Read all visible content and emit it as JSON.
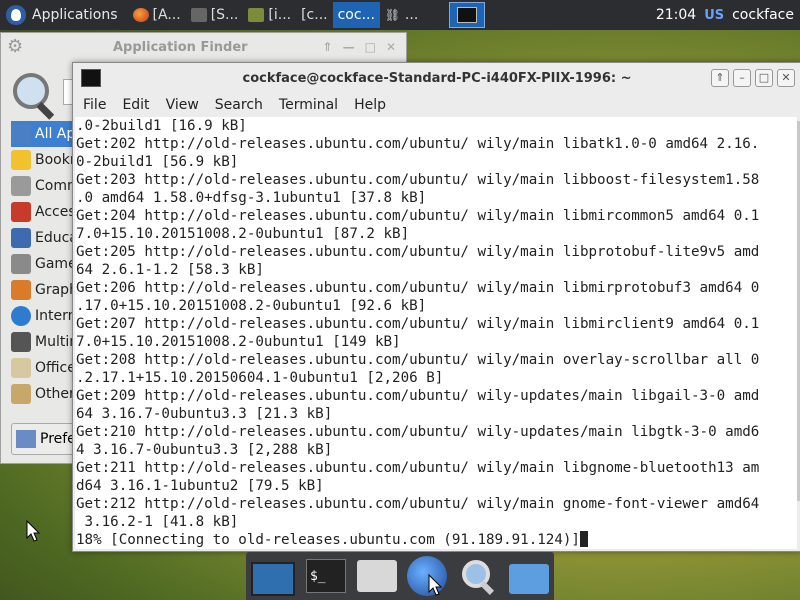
{
  "top_panel": {
    "applications_label": "Applications",
    "tasks": [
      {
        "label": "[A...",
        "icon": "firefox-icon"
      },
      {
        "label": "[S...",
        "icon": "window-icon"
      },
      {
        "label": "[i...",
        "icon": "image-icon"
      },
      {
        "label": "[c...",
        "icon": "terminal-icon"
      },
      {
        "label": "coc...",
        "icon": "terminal-icon"
      },
      {
        "label": "...",
        "icon": "chain-icon"
      }
    ],
    "clock": "21:04",
    "keyboard_layout": "US",
    "user": "cockface"
  },
  "app_finder": {
    "title": "Application Finder",
    "categories": [
      "All Applications",
      "Bookmarks",
      "Common",
      "Accessories",
      "Education",
      "Games",
      "Graphics",
      "Internet",
      "Multimedia",
      "Office",
      "Other"
    ],
    "preferences_label": "Preferences"
  },
  "terminal": {
    "title": "cockface@cockface-Standard-PC-i440FX-PIIX-1996: ~",
    "menu": [
      "File",
      "Edit",
      "View",
      "Search",
      "Terminal",
      "Help"
    ],
    "lines": [
      ".0-2build1 [16.9 kB]",
      "Get:202 http://old-releases.ubuntu.com/ubuntu/ wily/main libatk1.0-0 amd64 2.16.",
      "0-2build1 [56.9 kB]",
      "Get:203 http://old-releases.ubuntu.com/ubuntu/ wily/main libboost-filesystem1.58",
      ".0 amd64 1.58.0+dfsg-3.1ubuntu1 [37.8 kB]",
      "Get:204 http://old-releases.ubuntu.com/ubuntu/ wily/main libmircommon5 amd64 0.1",
      "7.0+15.10.20151008.2-0ubuntu1 [87.2 kB]",
      "Get:205 http://old-releases.ubuntu.com/ubuntu/ wily/main libprotobuf-lite9v5 amd",
      "64 2.6.1-1.2 [58.3 kB]",
      "Get:206 http://old-releases.ubuntu.com/ubuntu/ wily/main libmirprotobuf3 amd64 0",
      ".17.0+15.10.20151008.2-0ubuntu1 [92.6 kB]",
      "Get:207 http://old-releases.ubuntu.com/ubuntu/ wily/main libmirclient9 amd64 0.1",
      "7.0+15.10.20151008.2-0ubuntu1 [149 kB]",
      "Get:208 http://old-releases.ubuntu.com/ubuntu/ wily/main overlay-scrollbar all 0",
      ".2.17.1+15.10.20150604.1-0ubuntu1 [2,206 B]",
      "Get:209 http://old-releases.ubuntu.com/ubuntu/ wily-updates/main libgail-3-0 amd",
      "64 3.16.7-0ubuntu3.3 [21.3 kB]",
      "Get:210 http://old-releases.ubuntu.com/ubuntu/ wily-updates/main libgtk-3-0 amd6",
      "4 3.16.7-0ubuntu3.3 [2,288 kB]",
      "Get:211 http://old-releases.ubuntu.com/ubuntu/ wily/main libgnome-bluetooth13 am",
      "d64 3.16.1-1ubuntu2 [79.5 kB]",
      "Get:212 http://old-releases.ubuntu.com/ubuntu/ wily/main gnome-font-viewer amd64",
      " 3.16.2-1 [41.8 kB]",
      "18% [Connecting to old-releases.ubuntu.com (91.189.91.124)]"
    ]
  },
  "dock": {
    "terminal_prompt": "$_"
  }
}
